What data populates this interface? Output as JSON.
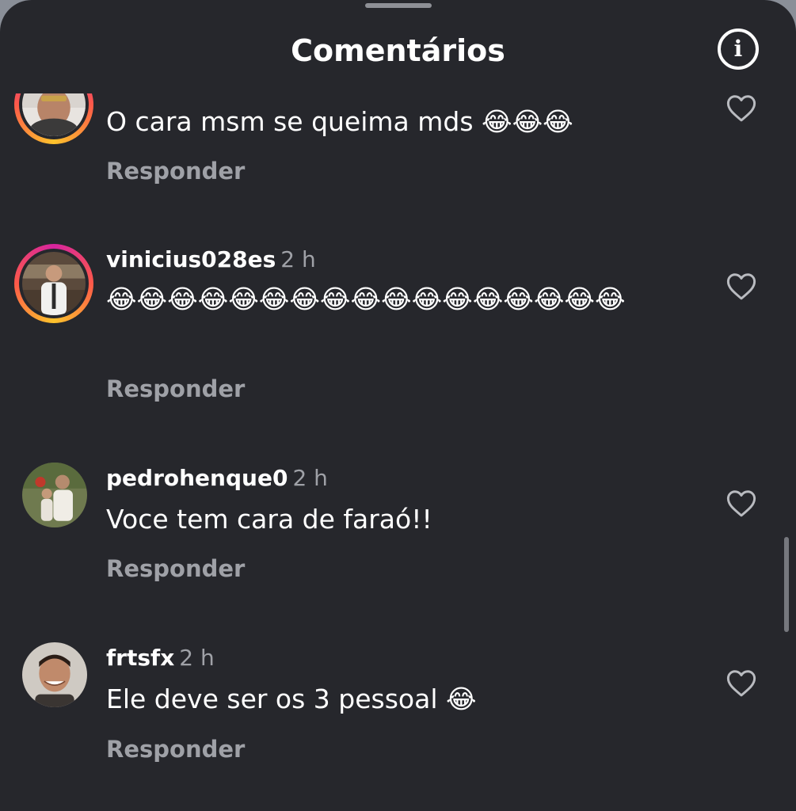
{
  "header": {
    "title": "Comentários",
    "info_icon": "info-icon",
    "info_glyph": "i"
  },
  "comments": [
    {
      "username": "",
      "time": "",
      "text": "O cara msm se queima mds 😂😂😂",
      "reply_label": "Responder",
      "has_story_ring": true
    },
    {
      "username": "vinicius028es",
      "time": "2 h",
      "text": "😂😂😂😂😂😂😂😂😂😂😂😂😂😂😂😂😂",
      "reply_label": "Responder",
      "has_story_ring": true
    },
    {
      "username": "pedrohenque0",
      "time": "2 h",
      "text": "Voce tem cara de faraó!!",
      "reply_label": "Responder",
      "has_story_ring": false
    },
    {
      "username": "frtsfx",
      "time": "2 h",
      "text": "Ele deve ser os 3 pessoal 😂",
      "reply_label": "Responder",
      "has_story_ring": false
    }
  ],
  "icons": {
    "like": "heart-outline-icon",
    "info": "info-icon"
  },
  "colors": {
    "background": "#26272c",
    "text": "#ffffff",
    "secondary_text": "#9fa1a7",
    "story_ring_start": "#d6249f",
    "story_ring_end": "#fdc32c"
  }
}
